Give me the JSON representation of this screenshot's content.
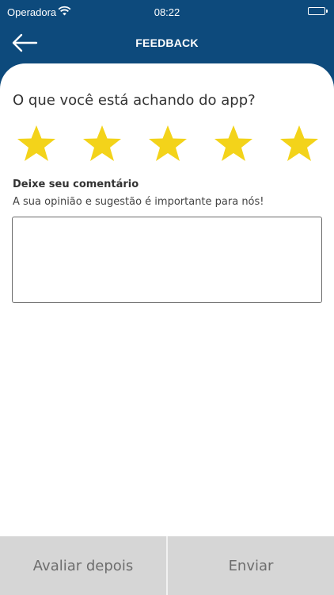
{
  "status_bar": {
    "carrier": "Operadora",
    "time": "08:22",
    "icons": [
      "wifi-icon",
      "battery-icon"
    ]
  },
  "nav": {
    "title": "FEEDBACK",
    "back_icon": "arrow-left-icon"
  },
  "rating": {
    "question": "O que você está achando do app?",
    "max": 5,
    "selected": 5,
    "star_color": "#f3d31a"
  },
  "comment": {
    "label": "Deixe seu comentário",
    "hint": "A sua opinião e sugestão é importante para nós!",
    "value": "",
    "placeholder": ""
  },
  "actions": {
    "later_label": "Avaliar depois",
    "send_label": "Enviar"
  },
  "colors": {
    "header": "#0d4a7c",
    "footer": "#d6d6d6",
    "footer_text": "#6d6d6d"
  }
}
